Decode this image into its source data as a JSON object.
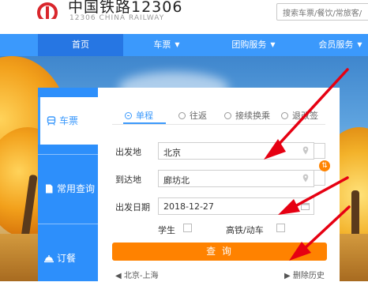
{
  "header": {
    "brand": "中国铁路12306",
    "brand_sub": "12306 CHINA RAILWAY",
    "search_placeholder": "搜索车票/餐饮/常旅客/"
  },
  "nav": {
    "items": [
      {
        "label": "首页"
      },
      {
        "label": "车票"
      },
      {
        "label": "团购服务"
      },
      {
        "label": "会员服务"
      }
    ]
  },
  "sidebar": {
    "items": [
      {
        "label": "车票"
      },
      {
        "label": "常用查询"
      },
      {
        "label": "订餐"
      }
    ]
  },
  "panel": {
    "tabs": [
      {
        "label": "单程"
      },
      {
        "label": "往返"
      },
      {
        "label": "接续换乘"
      },
      {
        "label": "退改签"
      }
    ],
    "from_label": "出发地",
    "from_value": "北京",
    "to_label": "到达地",
    "to_value": "廊坊北",
    "date_label": "出发日期",
    "date_value": "2018-12-27",
    "student_label": "学生",
    "highspeed_label": "高铁/动车",
    "query_label": "查 询",
    "history_item": "北京-上海",
    "clear_history": "删除历史"
  },
  "colors": {
    "primary": "#3b99fc",
    "nav_active": "#2676e3",
    "accent": "#ff8200",
    "logo_red": "#d9262c"
  }
}
